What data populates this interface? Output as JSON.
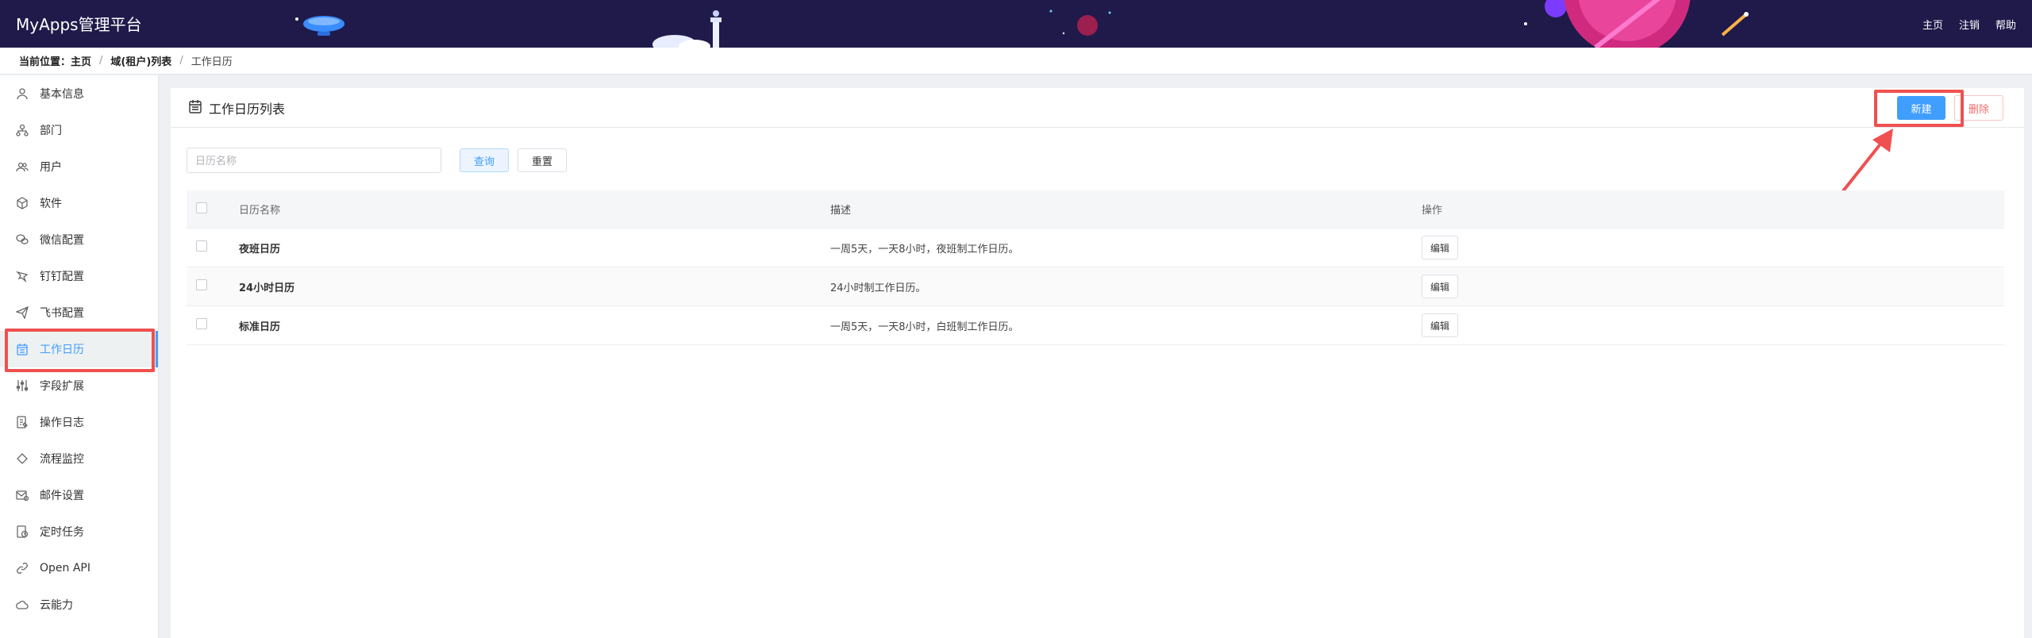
{
  "app": {
    "title": "MyApps管理平台"
  },
  "top_nav": [
    "主页",
    "注销",
    "帮助"
  ],
  "breadcrumb": {
    "prefix": "当前位置：",
    "items": [
      "主页",
      "域(租户)列表",
      "工作日历"
    ]
  },
  "sidebar": {
    "items": [
      {
        "label": "基本信息",
        "icon": "user-outline-icon"
      },
      {
        "label": "部门",
        "icon": "org-tree-icon"
      },
      {
        "label": "用户",
        "icon": "users-icon"
      },
      {
        "label": "软件",
        "icon": "cube-icon"
      },
      {
        "label": "微信配置",
        "icon": "wechat-icon"
      },
      {
        "label": "钉钉配置",
        "icon": "dingtalk-icon"
      },
      {
        "label": "飞书配置",
        "icon": "paper-plane-icon"
      },
      {
        "label": "工作日历",
        "icon": "calendar-icon",
        "active": true
      },
      {
        "label": "字段扩展",
        "icon": "sliders-icon"
      },
      {
        "label": "操作日志",
        "icon": "log-icon"
      },
      {
        "label": "流程监控",
        "icon": "diamond-icon"
      },
      {
        "label": "邮件设置",
        "icon": "mail-icon"
      },
      {
        "label": "定时任务",
        "icon": "timer-icon"
      },
      {
        "label": "Open API",
        "icon": "link-icon"
      },
      {
        "label": "云能力",
        "icon": "cloud-icon"
      }
    ]
  },
  "main": {
    "title": "工作日历列表",
    "buttons": {
      "new": "新建",
      "delete": "删除",
      "query": "查询",
      "reset": "重置"
    },
    "search": {
      "placeholder": "日历名称",
      "value": ""
    },
    "table": {
      "columns": [
        "日历名称",
        "描述",
        "操作"
      ],
      "rows": [
        {
          "name": "夜班日历",
          "desc": "一周5天，一天8小时，夜班制工作日历。",
          "action": "编辑"
        },
        {
          "name": "24小时日历",
          "desc": "24小时制工作日历。",
          "action": "编辑"
        },
        {
          "name": "标准日历",
          "desc": "一周5天，一天8小时，白班制工作日历。",
          "action": "编辑"
        }
      ]
    }
  },
  "colors": {
    "header_bg": "#1f1a4a",
    "accent": "#409eff",
    "danger": "#f56c6c",
    "highlight": "#f05050"
  }
}
